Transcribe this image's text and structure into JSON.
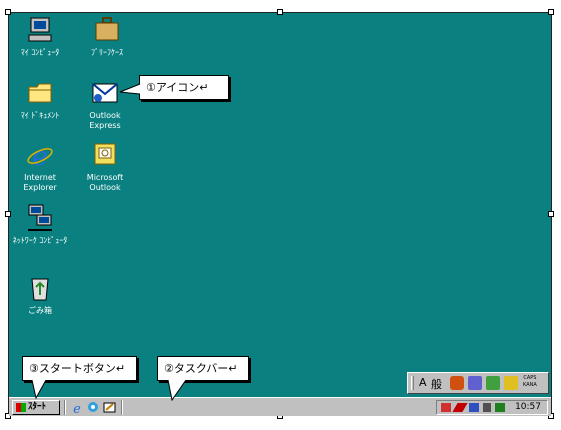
{
  "desktop": {
    "background_color": "#0b8080",
    "icons": [
      {
        "label": "ﾏｲ ｺﾝﾋﾟｭｰﾀ",
        "icon": "computer-icon"
      },
      {
        "label": "ﾌﾞﾘｰﾌｹｰｽ",
        "icon": "briefcase-icon"
      },
      {
        "label": "ﾏｲ ﾄﾞｷｭﾒﾝﾄ",
        "icon": "folder-icon"
      },
      {
        "label": "Outlook Express",
        "icon": "outlook-express-icon"
      },
      {
        "label": "Internet Explorer",
        "icon": "internet-explorer-icon"
      },
      {
        "label": "Microsoft Outlook",
        "icon": "microsoft-outlook-icon"
      },
      {
        "label": "ﾈｯﾄﾜｰｸ ｺﾝﾋﾟｭｰﾀ",
        "icon": "network-computer-icon"
      },
      {
        "label": "ごみ箱",
        "icon": "recycle-bin-icon"
      }
    ]
  },
  "callouts": {
    "icon": "①アイコン↵",
    "start_button": "③スタートボタン↵",
    "taskbar": "②タスクバー↵"
  },
  "taskbar": {
    "start_label": "ｽﾀｰﾄ",
    "quick_launch": [
      "internet-explorer-icon",
      "channels-icon",
      "show-desktop-icon"
    ],
    "clock": "10:57"
  },
  "ime_bar": {
    "mode": "A",
    "kanji": "般",
    "caps": "CAPS",
    "kana": "KANA"
  }
}
